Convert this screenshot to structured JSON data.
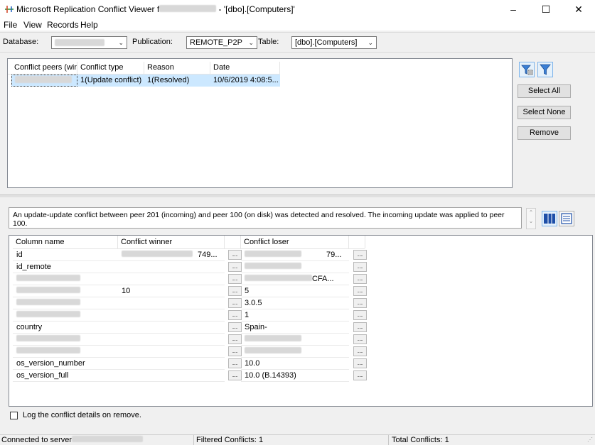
{
  "window": {
    "title": "Microsoft Replication Conflict Viewer f",
    "title_suffix": "- '[dbo].[Computers]'",
    "minimize": "–",
    "maximize": "☐",
    "close": "✕"
  },
  "menu": [
    "File",
    "View",
    "Records",
    "Help"
  ],
  "toolbar": {
    "database_label": "Database:",
    "publication_label": "Publication:",
    "publication_value": "REMOTE_P2P",
    "table_label": "Table:",
    "table_value": "[dbo].[Computers]"
  },
  "conflicts": {
    "columns": [
      "Conflict peers (win...",
      "Conflict type",
      "Reason",
      "Date"
    ],
    "rows": [
      {
        "type": "1(Update conflict)",
        "reason": "1(Resolved)",
        "date": "10/6/2019 4:08:5..."
      }
    ]
  },
  "side_buttons": {
    "select_all": "Select All",
    "select_none": "Select None",
    "remove": "Remove"
  },
  "message": "An update-update conflict between peer 201 (incoming) and peer 100 (on disk) was detected and resolved. The incoming update was applied to peer 100.",
  "details": {
    "columns": [
      "Column name",
      "Conflict winner",
      "Conflict loser"
    ],
    "rows": [
      {
        "name": "id",
        "winner": "",
        "loser": "",
        "winner_blurred": true,
        "loser_blurred": true,
        "winner_tail": "749...",
        "loser_tail": "79..."
      },
      {
        "name": "id_remote",
        "winner": "",
        "loser": "",
        "loser_blurred": true
      },
      {
        "name": "",
        "name_blurred": true,
        "winner": "",
        "loser": "CFA...",
        "loser_blurred": true
      },
      {
        "name": "",
        "name_blurred": true,
        "winner": "10",
        "loser": "5"
      },
      {
        "name": "",
        "name_blurred": true,
        "winner": "",
        "loser": "3.0.5"
      },
      {
        "name": "",
        "name_blurred": true,
        "winner": "",
        "loser": "1"
      },
      {
        "name": "country",
        "winner": "",
        "loser": "Spain-"
      },
      {
        "name": "",
        "name_blurred": true,
        "winner": "",
        "loser": "",
        "loser_blurred": true
      },
      {
        "name": "",
        "name_blurred": true,
        "winner": "",
        "loser": "",
        "loser_blurred": true
      },
      {
        "name": "os_version_number",
        "winner": "",
        "loser": "10.0"
      },
      {
        "name": "os_version_full",
        "winner": "",
        "loser": "10.0 (B.14393)"
      }
    ],
    "ellipsis": "..."
  },
  "log_checkbox_label": "Log the conflict details on remove.",
  "status": {
    "connected": "Connected to server",
    "filtered": "Filtered Conflicts: 1",
    "total": "Total Conflicts: 1"
  },
  "colors": {
    "accent": "#0078d7",
    "selection": "#cce8ff",
    "border": "#828790"
  }
}
